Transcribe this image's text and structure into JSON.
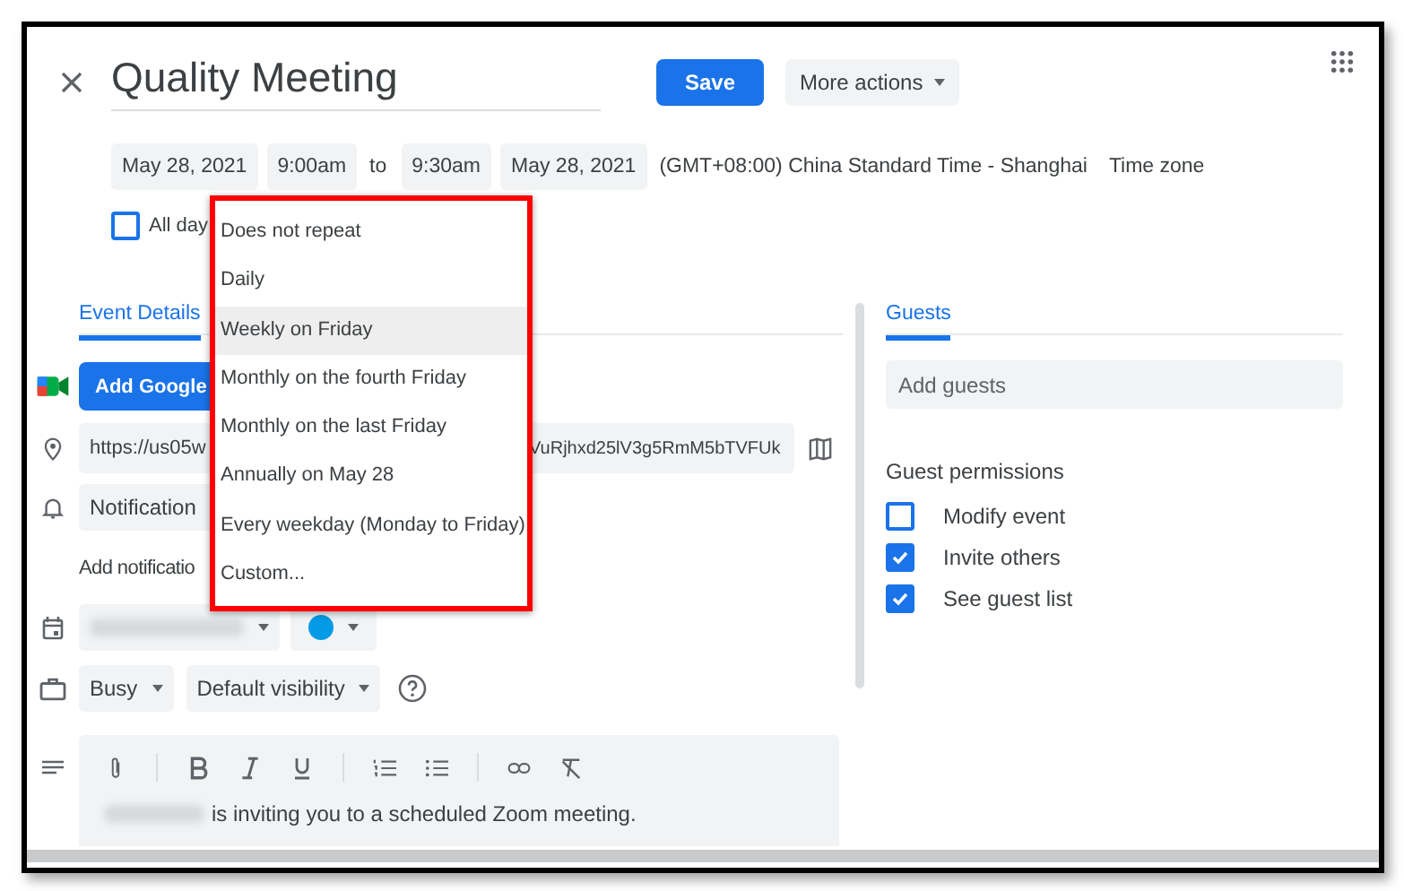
{
  "title": "Quality Meeting",
  "save": "Save",
  "more_actions": "More actions",
  "date_row": {
    "start_date": "May 28, 2021",
    "start_time": "9:00am",
    "to": "to",
    "end_time": "9:30am",
    "end_date": "May 28, 2021",
    "timezone_value": "(GMT+08:00) China Standard Time - Shanghai",
    "timezone_link": "Time zone"
  },
  "all_day": {
    "label": "All day",
    "checked": false
  },
  "repeat_menu": [
    {
      "label": "Does not repeat",
      "selected": false
    },
    {
      "label": "Daily",
      "selected": false
    },
    {
      "label": "Weekly on Friday",
      "selected": true
    },
    {
      "label": "Monthly on the fourth Friday",
      "selected": false
    },
    {
      "label": "Monthly on the last Friday",
      "selected": false
    },
    {
      "label": "Annually on May 28",
      "selected": false
    },
    {
      "label": "Every weekday (Monday to Friday)",
      "selected": false
    },
    {
      "label": "Custom...",
      "selected": false
    }
  ],
  "details_tab": {
    "label": "Event Details",
    "selected": true
  },
  "details": {
    "conference_button": "Add Google",
    "location_start": "https://us05w",
    "location_end": "VuRjhxd25lV3g5RmM5bTVFUk",
    "notification": "Notification",
    "add_notification": "Add notificatio",
    "status": "Busy",
    "visibility": "Default visibility",
    "description": "is inviting you to a scheduled Zoom meeting."
  },
  "guests_tab": {
    "label": "Guests",
    "selected": true
  },
  "guests": {
    "placeholder": "Add guests",
    "permissions_title": "Guest permissions",
    "permissions": [
      {
        "label": "Modify event",
        "checked": false
      },
      {
        "label": "Invite others",
        "checked": true
      },
      {
        "label": "See guest list",
        "checked": true
      }
    ]
  }
}
